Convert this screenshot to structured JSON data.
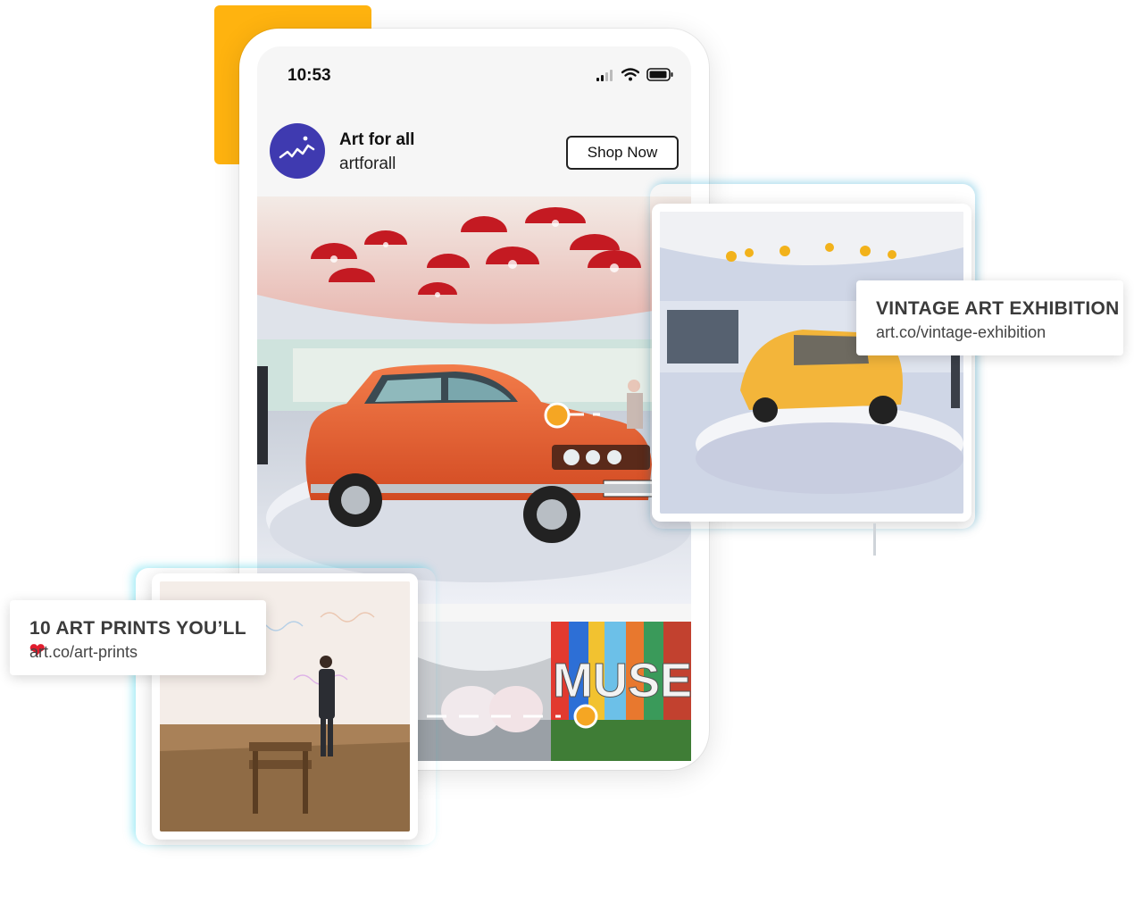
{
  "status_bar": {
    "time": "10:53"
  },
  "post": {
    "brand_name": "Art for all",
    "handle": "artforall",
    "cta_label": "Shop Now",
    "main_image": "Orange vintage car on display under red hanging lamps",
    "thumbnails": [
      "Museum gallery with white pods",
      "Colorful MUSEUM sign"
    ]
  },
  "cards": {
    "right": {
      "image": "Yellow bubble car on exhibition platform",
      "title": "VINTAGE ART EXHIBITION",
      "url": "art.co/vintage-exhibition"
    },
    "left": {
      "image": "Man viewing large art prints in gallery",
      "title": "10 ART PRINTS YOU’LL",
      "url": "art.co/art-prints"
    }
  },
  "colors": {
    "accent": "#ffb30f",
    "avatar": "#3f3ab0",
    "marker": "#f5a623"
  },
  "icons": [
    "signal-icon",
    "wifi-icon",
    "battery-icon",
    "heart-icon"
  ]
}
